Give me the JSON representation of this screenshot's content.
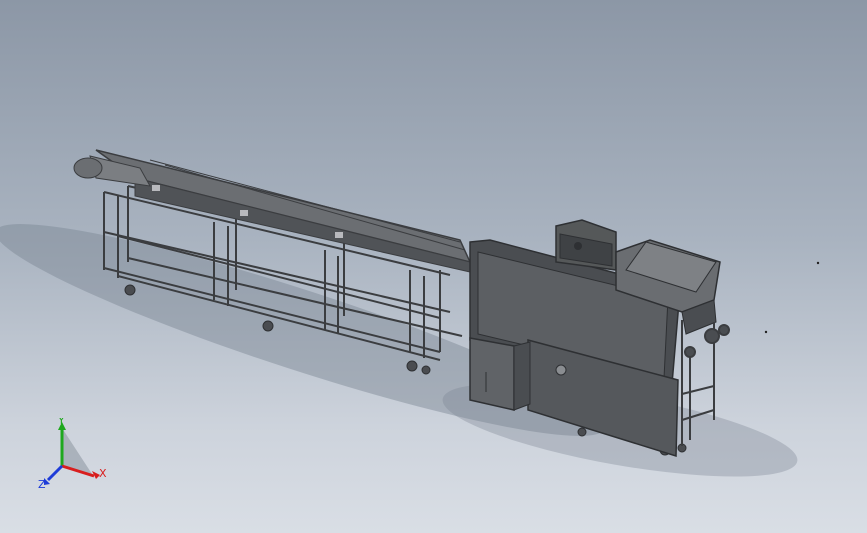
{
  "triad": {
    "x_label": "X",
    "y_label": "Y",
    "z_label": "Z",
    "x_color": "#d81e1e",
    "y_color": "#1ea81e",
    "z_color": "#1e3cd8"
  },
  "colors": {
    "frame": "#5a5d61",
    "frame_dark": "#3d3f42",
    "panel": "#55585c",
    "panel_light": "#7b7e82",
    "shadow": "#6d7886"
  }
}
